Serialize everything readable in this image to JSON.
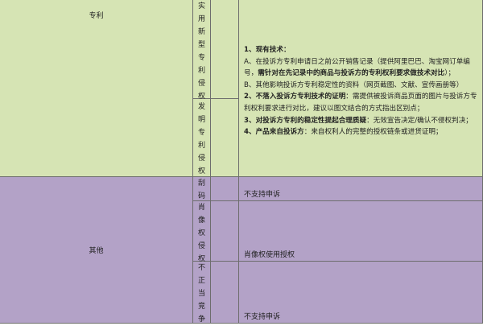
{
  "patent": {
    "category": "专利",
    "utility": [
      "实",
      "用",
      "新",
      "型",
      "专",
      "利",
      "侵",
      "权"
    ],
    "invention": [
      "发",
      "明",
      "专",
      "利",
      "侵",
      "权"
    ],
    "requirements": {
      "p1_title": "1、现有技术：",
      "p1_a": "A、在投诉方专利申请日之前公开销售记录（提供阿里巴巴、淘宝网订单编号，",
      "p1_a_bold": "需针对在先记录中的商品与投诉方的专利权利要求做技术对比",
      "p1_a_end": "）；",
      "p1_b": "B、其他影响投诉方专利稳定性的资料（网页截图、文献、宣传画册等）",
      "p2_title": "2、不落入投诉方专利技术的证明",
      "p2_text": "：需提供被投诉商品页面的图片与投诉方专利权利要求进行对比，建议以图文结合的方式指出区别点；",
      "p3_title": "3、对投诉方专利的稳定性提起合理质疑",
      "p3_text": "：无效宣告决定/确认不侵权判决；",
      "p4_title": "4、产品来自投诉方",
      "p4_text": "：来自权利人的完整的授权链条或进货证明；"
    }
  },
  "other": {
    "category": "其他",
    "rows": [
      {
        "chars": [
          "刮",
          "码"
        ],
        "value": "不支持申诉"
      },
      {
        "chars": [
          "肖",
          "像",
          "权",
          "侵",
          "权"
        ],
        "value": "肖像权使用授权"
      },
      {
        "chars": [
          "不",
          "正",
          "当",
          "竞",
          "争"
        ],
        "value": "不支持申诉"
      }
    ]
  }
}
